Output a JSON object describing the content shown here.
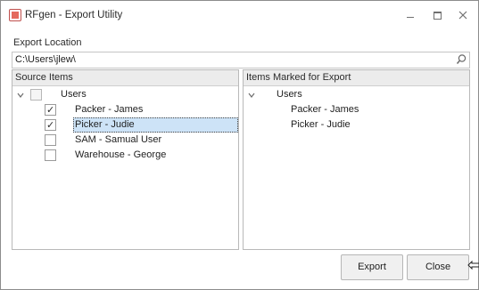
{
  "window": {
    "title": "RFgen - Export Utility",
    "icon": "app-icon"
  },
  "export_location": {
    "label": "Export Location",
    "value": "C:\\Users\\jlew\\"
  },
  "source_panel": {
    "header": "Source Items",
    "root": {
      "label": "Users",
      "expanded": true,
      "checked": "none"
    },
    "items": [
      {
        "label": "Packer - James",
        "checked": true
      },
      {
        "label": "Picker - Judie",
        "checked": true,
        "selected": true
      },
      {
        "label": "SAM - Samual User",
        "checked": false
      },
      {
        "label": "Warehouse - George",
        "checked": false
      }
    ]
  },
  "export_panel": {
    "header": "Items Marked for Export",
    "root": {
      "label": "Users",
      "expanded": true
    },
    "items": [
      {
        "label": "Packer - James"
      },
      {
        "label": "Picker - Judie"
      }
    ]
  },
  "buttons": {
    "export": "Export",
    "close": "Close"
  },
  "colors": {
    "selection": "#cde3f7",
    "header_bg": "#ececec",
    "button_bg": "#f0f0f0"
  }
}
